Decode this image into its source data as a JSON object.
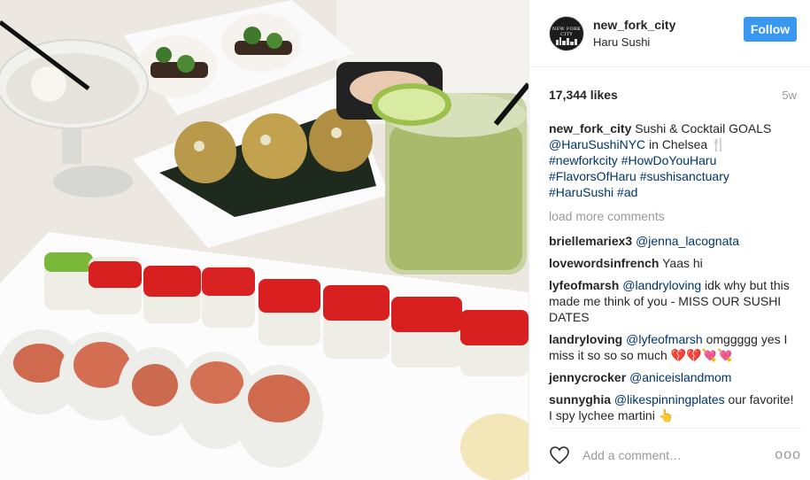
{
  "photo": {
    "alt_subject": "sushi and cocktails"
  },
  "header": {
    "avatar_text": "NEW FORK CITY",
    "username": "new_fork_city",
    "location": "Haru Sushi",
    "follow_label": "Follow"
  },
  "stats": {
    "likes": "17,344 likes",
    "age": "5w"
  },
  "caption": {
    "username": "new_fork_city",
    "text1": " Sushi & Cocktail GOALS ",
    "mention": "@HaruSushiNYC",
    "text2": " in Chelsea 🍴",
    "hashtags_line1": "#newforkcity #HowDoYouHaru",
    "hashtags_line2": "#FlavorsOfHaru #sushisanctuary",
    "hashtags_line3": "#HaruSushi #ad"
  },
  "load_more": "load more comments",
  "comments": [
    {
      "user": "briellemariex3",
      "mention": "@jenna_lacognata",
      "text": ""
    },
    {
      "user": "lovewordsinfrench",
      "mention": "",
      "text": " Yaas hi"
    },
    {
      "user": "lyfeofmarsh",
      "mention": "@landryloving",
      "text": " idk why but this made me think of you - MISS OUR SUSHI DATES"
    },
    {
      "user": "landryloving",
      "mention": "@lyfeofmarsh",
      "text": " omggggg yes I miss it so so so much 💔💔💘💘"
    },
    {
      "user": "jennycrocker",
      "mention": "@aniceislandmom",
      "text": ""
    },
    {
      "user": "sunnyghia",
      "mention": "@likespinningplates",
      "text": " our favorite! I spy lychee martini 👆"
    }
  ],
  "add_comment": {
    "placeholder": "Add a comment…",
    "more": "ooo"
  },
  "colors": {
    "follow_button": "#3897f0",
    "link": "#003569",
    "muted": "#999999"
  }
}
